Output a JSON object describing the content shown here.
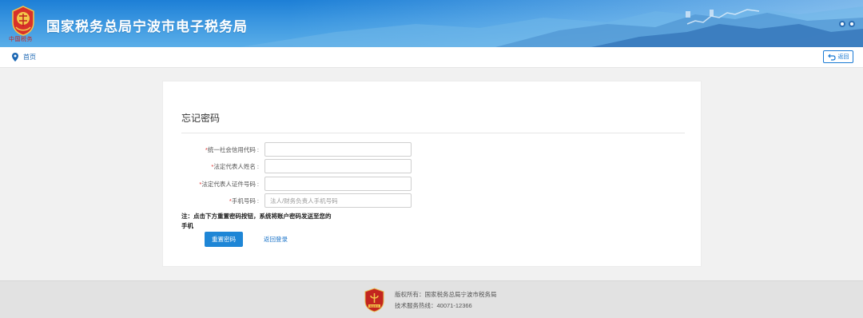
{
  "header": {
    "title": "国家税务总局宁波市电子税务局",
    "logo_script": "中国税务",
    "icons": [
      "search-icon",
      "zoom-icon"
    ]
  },
  "breadcrumb": {
    "icon": "location-pin-icon",
    "home": "首页",
    "back_label": "返回"
  },
  "form": {
    "title": "忘记密码",
    "fields": [
      {
        "required_mark": "*",
        "label": "统一社会信用代码 :",
        "value": "",
        "placeholder": ""
      },
      {
        "required_mark": "*",
        "label": "法定代表人姓名 :",
        "value": "",
        "placeholder": ""
      },
      {
        "required_mark": "*",
        "label": "法定代表人证件号码 :",
        "value": "",
        "placeholder": ""
      },
      {
        "required_mark": "*",
        "label": "手机号码 :",
        "value": "",
        "placeholder": "法人/财务负责人手机号码"
      }
    ],
    "note": "注：点击下方重置密码按钮，系统将账户密码发送至您的手机",
    "reset_button": "重置密码",
    "back_login_link": "返回登录"
  },
  "footer": {
    "copyright": "版权所有：国家税务总局宁波市税务局",
    "hotline": "技术服务热线：40071-12366",
    "badge_text": "党政机关"
  },
  "colors": {
    "header_blue": "#1d7fd6",
    "accent": "#1e86d6",
    "required": "#e0332f",
    "link": "#1a73c8"
  }
}
